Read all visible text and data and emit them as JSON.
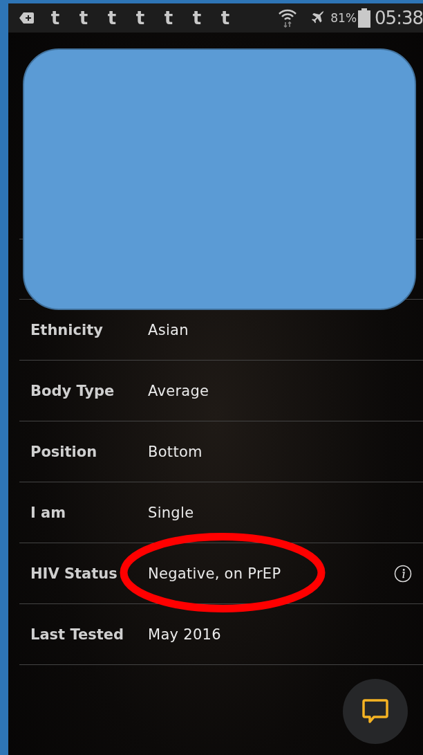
{
  "status_bar": {
    "notification_icons": [
      "t",
      "t",
      "t",
      "t",
      "t",
      "t",
      "t"
    ],
    "battery_percent": "81%",
    "time": "05:38"
  },
  "profile_fields": [
    {
      "label": "Ethnicity",
      "value": "Asian",
      "info": false,
      "circled": false
    },
    {
      "label": "Body Type",
      "value": "Average",
      "info": false,
      "circled": false
    },
    {
      "label": "Position",
      "value": "Bottom",
      "info": false,
      "circled": false
    },
    {
      "label": "I am",
      "value": "Single",
      "info": false,
      "circled": false
    },
    {
      "label": "HIV Status",
      "value": "Negative, on PrEP",
      "info": true,
      "circled": true
    },
    {
      "label": "Last Tested",
      "value": "May 2016",
      "info": false,
      "circled": false
    }
  ]
}
